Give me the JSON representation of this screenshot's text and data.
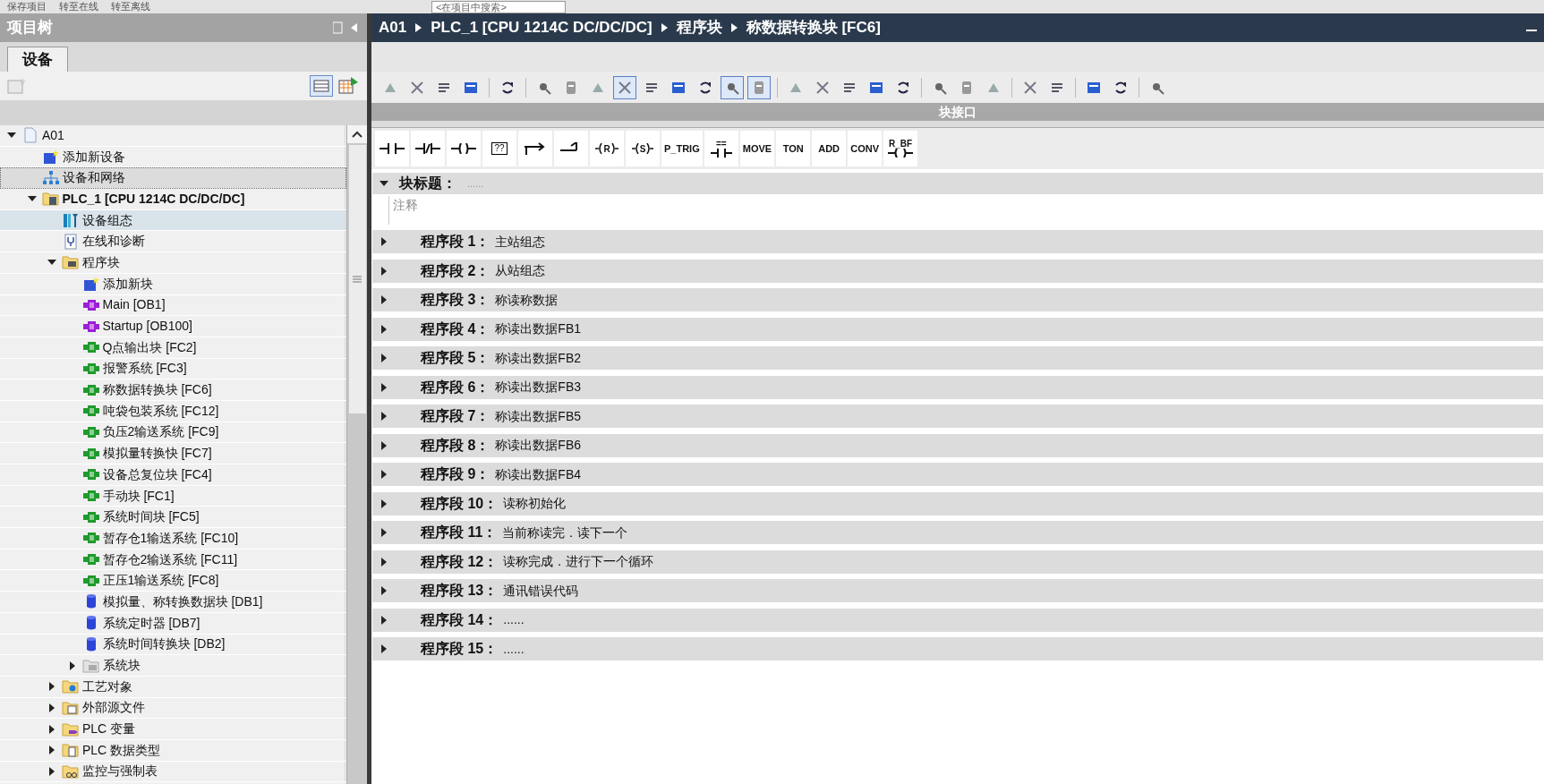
{
  "top_toolbar": {
    "items": [
      "保存项目",
      "转至在线",
      "转至离线"
    ],
    "search": {
      "placeholder": "<在项目中搜索>"
    }
  },
  "project_tree": {
    "title": "项目树",
    "tabs": [
      {
        "label": "设备",
        "selected": true
      }
    ],
    "items": [
      {
        "label": "A01",
        "kind": "project",
        "expanded": true,
        "selected": false,
        "children": [
          {
            "label": "添加新设备",
            "kind": "add",
            "selected": false
          },
          {
            "label": "设备和网络",
            "kind": "network",
            "selected": false,
            "focused": true
          },
          {
            "label": "PLC_1 [CPU 1214C DC/DC/DC]",
            "kind": "plc",
            "expanded": true,
            "selected": false,
            "children": [
              {
                "label": "设备组态",
                "kind": "config",
                "selected": true
              },
              {
                "label": "在线和诊断",
                "kind": "diag",
                "selected": false
              },
              {
                "label": "程序块",
                "kind": "blocks",
                "expanded": true,
                "selected": false,
                "children": [
                  {
                    "label": "添加新块",
                    "kind": "add",
                    "selected": false
                  },
                  {
                    "label": "Main [OB1]",
                    "kind": "ob",
                    "selected": false
                  },
                  {
                    "label": "Startup [OB100]",
                    "kind": "ob",
                    "selected": false
                  },
                  {
                    "label": "Q点输出块 [FC2]",
                    "kind": "fc",
                    "selected": false
                  },
                  {
                    "label": "报警系统 [FC3]",
                    "kind": "fc",
                    "selected": false
                  },
                  {
                    "label": "称数据转换块 [FC6]",
                    "kind": "fc",
                    "selected": false
                  },
                  {
                    "label": "吨袋包装系统 [FC12]",
                    "kind": "fc",
                    "selected": false
                  },
                  {
                    "label": "负压2输送系统 [FC9]",
                    "kind": "fc",
                    "selected": false
                  },
                  {
                    "label": "模拟量转换快 [FC7]",
                    "kind": "fc",
                    "selected": false
                  },
                  {
                    "label": "设备总复位块 [FC4]",
                    "kind": "fc",
                    "selected": false
                  },
                  {
                    "label": "手动块 [FC1]",
                    "kind": "fc",
                    "selected": false
                  },
                  {
                    "label": "系统时间块 [FC5]",
                    "kind": "fc",
                    "selected": false
                  },
                  {
                    "label": "暂存仓1输送系统 [FC10]",
                    "kind": "fc",
                    "selected": false
                  },
                  {
                    "label": "暂存仓2输送系统 [FC11]",
                    "kind": "fc",
                    "selected": false
                  },
                  {
                    "label": "正压1输送系统 [FC8]",
                    "kind": "fc",
                    "selected": false
                  },
                  {
                    "label": "模拟量、称转换数据块 [DB1]",
                    "kind": "db",
                    "selected": false
                  },
                  {
                    "label": "系统定时器 [DB7]",
                    "kind": "db",
                    "selected": false
                  },
                  {
                    "label": "系统时间转换块 [DB2]",
                    "kind": "db",
                    "selected": false
                  },
                  {
                    "label": "系统块",
                    "kind": "sysblocks",
                    "expanded": false,
                    "selected": false
                  }
                ]
              },
              {
                "label": "工艺对象",
                "kind": "tech",
                "expanded": false,
                "selected": false
              },
              {
                "label": "外部源文件",
                "kind": "source",
                "expanded": false,
                "selected": false
              },
              {
                "label": "PLC 变量",
                "kind": "tags",
                "expanded": false,
                "selected": false
              },
              {
                "label": "PLC 数据类型",
                "kind": "types",
                "expanded": false,
                "selected": false
              },
              {
                "label": "监控与强制表",
                "kind": "watch",
                "expanded": false,
                "selected": false
              }
            ]
          }
        ]
      }
    ]
  },
  "breadcrumb": [
    "A01",
    "PLC_1 [CPU 1214C DC/DC/DC]",
    "程序块",
    "称数据转换块 [FC6]"
  ],
  "editor_toolbar": [
    {
      "pressed": false
    },
    {
      "pressed": false
    },
    {
      "pressed": false
    },
    {
      "pressed": false
    },
    {
      "pressed": false
    },
    {
      "pressed": false
    },
    {
      "pressed": false
    },
    {
      "pressed": false
    },
    {
      "pressed": true
    },
    {
      "pressed": false
    },
    {
      "pressed": false
    },
    {
      "pressed": false
    },
    {
      "pressed": true
    },
    {
      "pressed": true
    },
    {
      "pressed": false
    },
    {
      "pressed": false
    },
    {
      "pressed": false
    },
    {
      "pressed": false
    },
    {
      "pressed": false
    },
    {
      "pressed": false
    },
    {
      "pressed": false
    },
    {
      "pressed": false
    },
    {
      "pressed": false
    },
    {
      "pressed": false
    },
    {
      "pressed": false
    },
    {
      "pressed": false
    },
    {
      "pressed": false
    }
  ],
  "interface_bar": {
    "title": "块接口"
  },
  "instructions": [
    {
      "kind": "contact"
    },
    {
      "kind": "nc-contact"
    },
    {
      "kind": "coil"
    },
    {
      "kind": "empty-box",
      "text": "??"
    },
    {
      "kind": "branch-open"
    },
    {
      "kind": "branch-close"
    },
    {
      "kind": "letter-coil",
      "text": "R"
    },
    {
      "kind": "letter-coil",
      "text": "S"
    },
    {
      "kind": "label",
      "text": "P_TRIG"
    },
    {
      "kind": "compare",
      "text": "=="
    },
    {
      "kind": "label",
      "text": "MOVE"
    },
    {
      "kind": "label",
      "text": "TON"
    },
    {
      "kind": "label",
      "text": "ADD"
    },
    {
      "kind": "label",
      "text": "CONV"
    },
    {
      "kind": "label-coil",
      "text": "R_BF"
    }
  ],
  "block": {
    "label": "块标题：",
    "title": "......",
    "expanded": true,
    "comment_placeholder": "注释"
  },
  "networks": [
    {
      "label": "程序段 1：",
      "title": "主站组态",
      "expanded": false
    },
    {
      "label": "程序段 2：",
      "title": "从站组态",
      "expanded": false
    },
    {
      "label": "程序段 3：",
      "title": "称读称数据",
      "expanded": false
    },
    {
      "label": "程序段 4：",
      "title": "称读出数据FB1",
      "expanded": false
    },
    {
      "label": "程序段 5：",
      "title": "称读出数据FB2",
      "expanded": false
    },
    {
      "label": "程序段 6：",
      "title": "称读出数据FB3",
      "expanded": false
    },
    {
      "label": "程序段 7：",
      "title": "称读出数据FB5",
      "expanded": false
    },
    {
      "label": "程序段 8：",
      "title": "称读出数据FB6",
      "expanded": false
    },
    {
      "label": "程序段 9：",
      "title": "称读出数据FB4",
      "expanded": false
    },
    {
      "label": "程序段 10：",
      "title": "读称初始化",
      "expanded": false
    },
    {
      "label": "程序段 11：",
      "title": "当前称读完．读下一个",
      "expanded": false
    },
    {
      "label": "程序段 12：",
      "title": "读称完成．进行下一个循环",
      "expanded": false
    },
    {
      "label": "程序段 13：",
      "title": "通讯错误代码",
      "expanded": false
    },
    {
      "label": "程序段 14：",
      "title": "......",
      "expanded": false
    },
    {
      "label": "程序段 15：",
      "title": "......",
      "expanded": false
    }
  ]
}
